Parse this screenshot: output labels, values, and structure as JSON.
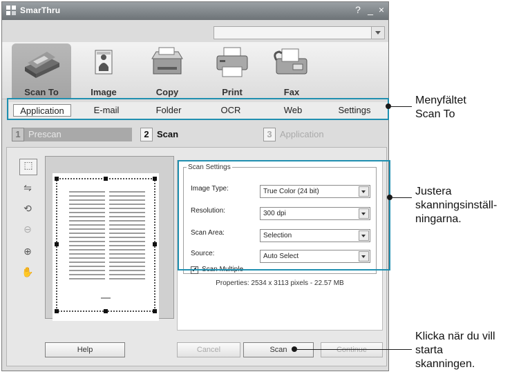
{
  "window": {
    "title": "SmarThru"
  },
  "title_controls": [
    "?",
    "_",
    "×"
  ],
  "toolbar": {
    "tools": [
      {
        "label": "Scan To",
        "icon": "scanner-icon"
      },
      {
        "label": "Image",
        "icon": "image-icon"
      },
      {
        "label": "Copy",
        "icon": "copier-icon"
      },
      {
        "label": "Print",
        "icon": "printer-icon"
      },
      {
        "label": "Fax",
        "icon": "fax-icon"
      }
    ]
  },
  "menu": {
    "items": [
      "Application",
      "E-mail",
      "Folder",
      "OCR",
      "Web",
      "Settings"
    ],
    "active": "Application"
  },
  "steps": [
    {
      "num": "1",
      "label": "Prescan"
    },
    {
      "num": "2",
      "label": "Scan"
    },
    {
      "num": "3",
      "label": "Application"
    }
  ],
  "scan_settings": {
    "legend": "Scan Settings",
    "image_type_label": "Image Type:",
    "image_type_value": "True Color (24 bit)",
    "resolution_label": "Resolution:",
    "resolution_value": "300 dpi",
    "scan_area_label": "Scan Area:",
    "scan_area_value": "Selection",
    "source_label": "Source:",
    "source_value": "Auto Select",
    "scan_multiple_label": "Scan Multiple",
    "scan_multiple_checked": true
  },
  "properties": "Properties: 2534 x 3113 pixels - 22.57 MB",
  "buttons": {
    "help": "Help",
    "cancel": "Cancel",
    "scan": "Scan",
    "continue": "Continue"
  },
  "annotations": {
    "menu": [
      "Menyfältet",
      "Scan To"
    ],
    "settings": [
      "Justera",
      "skanningsinställ-",
      "ningarna."
    ],
    "scan": [
      "Klicka när du vill",
      "starta",
      "skanningen."
    ]
  },
  "colors": {
    "callout": "#1f8fb0"
  }
}
